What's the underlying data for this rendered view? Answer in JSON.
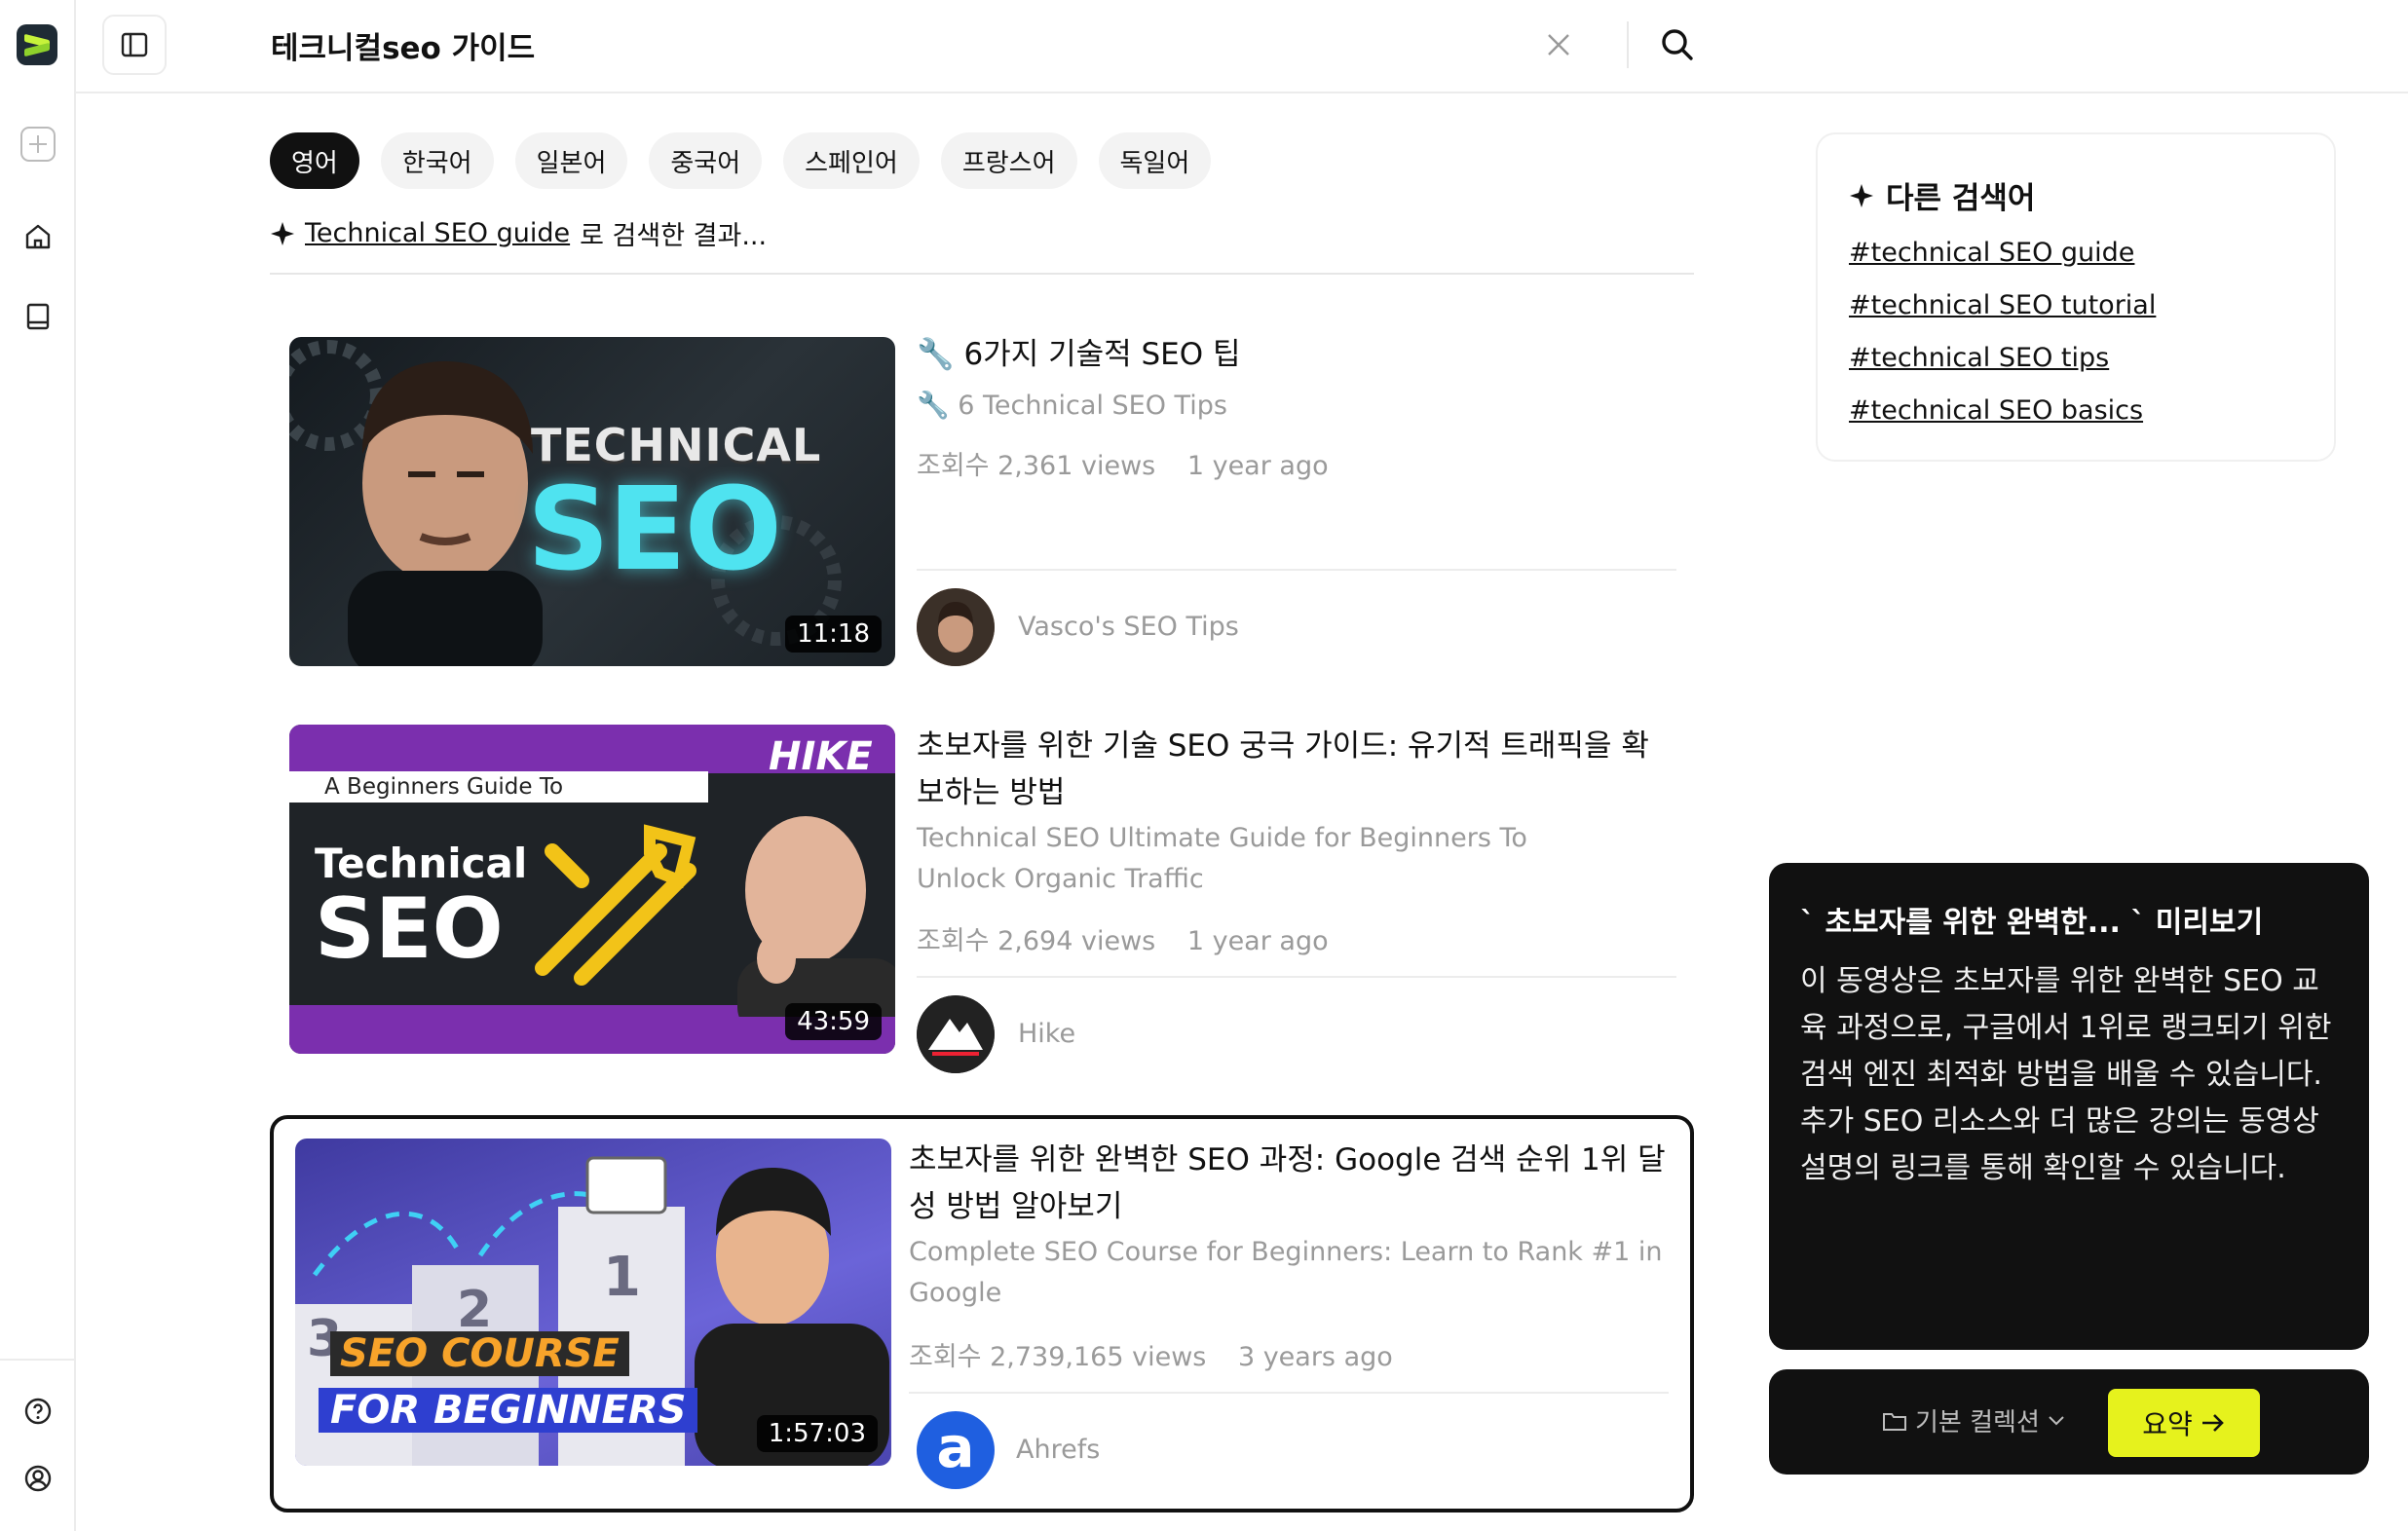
{
  "app": {
    "accent": "#e6f21d",
    "dark": "#111111"
  },
  "search": {
    "query": "테크니컬seo 가이드"
  },
  "language_tabs": [
    {
      "label": "영어",
      "active": true
    },
    {
      "label": "한국어",
      "active": false
    },
    {
      "label": "일본어",
      "active": false
    },
    {
      "label": "중국어",
      "active": false
    },
    {
      "label": "스페인어",
      "active": false
    },
    {
      "label": "프랑스어",
      "active": false
    },
    {
      "label": "독일어",
      "active": false
    }
  ],
  "searched_for": {
    "term": "Technical SEO guide",
    "suffix": "로 검색한 결과..."
  },
  "results": [
    {
      "title": "🔧 6가지 기술적 SEO 팁",
      "subtitle": "🔧 6 Technical SEO Tips",
      "views": "조회수 2,361 views",
      "age": "1 year ago",
      "channel": "Vasco's SEO Tips",
      "duration": "11:18",
      "thumb_text_1": "TECHNICAL",
      "thumb_text_2": "SEO"
    },
    {
      "title": "초보자를 위한 기술 SEO 궁극 가이드: 유기적 트래픽을 확보하는 방법",
      "subtitle": "Technical SEO Ultimate Guide for Beginners To Unlock Organic Traffic",
      "views": "조회수 2,694 views",
      "age": "1 year ago",
      "channel": "Hike",
      "duration": "43:59",
      "thumb_text_1": "A Beginners Guide To",
      "thumb_text_2": "Technical",
      "thumb_text_3": "SEO",
      "thumb_logo": "HIKE"
    },
    {
      "title": "초보자를 위한 완벽한 SEO 과정: Google 검색 순위 1위 달성 방법 알아보기",
      "subtitle": "Complete SEO Course for Beginners: Learn to Rank #1 in Google",
      "views": "조회수 2,739,165 views",
      "age": "3 years ago",
      "channel": "Ahrefs",
      "duration": "1:57:03",
      "thumb_text_1": "SEO COURSE",
      "thumb_text_2": "FOR BEGINNERS",
      "thumb_rank_1": "1",
      "thumb_rank_2": "2",
      "thumb_rank_3": "3",
      "channel_logo": "a"
    }
  ],
  "related": {
    "title": "다른 검색어",
    "tags": [
      "#technical SEO guide",
      "#technical SEO tutorial",
      "#technical SEO tips",
      "#technical SEO basics"
    ]
  },
  "preview": {
    "title": "` 초보자를 위한 완벽한... ` 미리보기",
    "text": "이 동영상은 초보자를 위한 완벽한 SEO 교육 과정으로, 구글에서 1위로 랭크되기 위한 검색 엔진 최적화 방법을 배울 수 있습니다. 추가 SEO 리소스와 더 많은 강의는 동영상 설명의 링크를 통해 확인할 수 있습니다."
  },
  "actions": {
    "collection": "기본 컬렉션",
    "summary": "요약"
  }
}
